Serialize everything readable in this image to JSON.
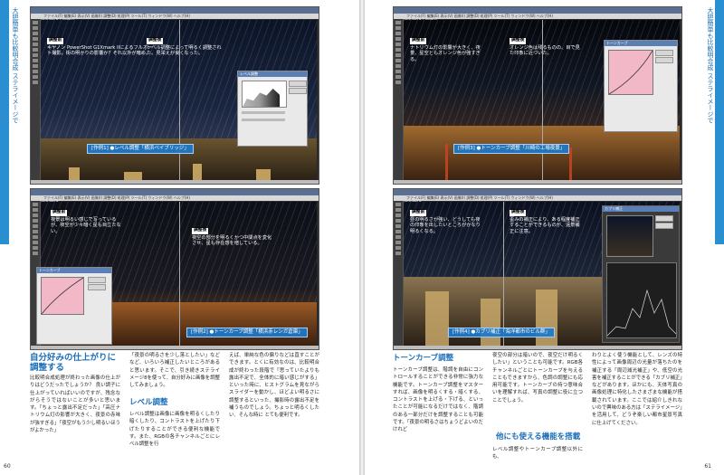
{
  "left_page": {
    "side_label": "大胆簡単も比較明合成 ステライメージで",
    "number": "60",
    "screenshot1": {
      "title": "StellaImage 8 - [作例1]",
      "menu": "ファイル(F) 編集(E) 表示(V) 画像(I) 調整(D) 処理(P) ツール(T) ウィンドウ(W) ヘルプ(H)",
      "note_left_tag": "調整前",
      "note_left_text": "キヤノン PowerShot G1Xmark IIによるフルオート撮影。街の明かりの影響か？それ以外が暗め。",
      "note_right_tag": "調整後",
      "note_right_text": "レベル調整によって明るく調整された。見栄えが良くなった。",
      "caption": "[作例1] ●レベル調整「横浜ベイブリッジ」",
      "dialog_title": "レベル調整"
    },
    "screenshot2": {
      "title": "StellaImage 8",
      "note_left_tag": "調整前",
      "note_left_text": "夜景は明るい感じで写っているが、夜空が少々暗く星も目立たない。",
      "note_right_tag": "調整後",
      "note_right_text": "夜空の部分を明るくかつ中間点を変化させ、星も存在感を増している。",
      "caption": "[作例2] ●トーンカーブ調整「横浜赤レンガ倉庫」",
      "dialog_title": "トーンカーブ"
    },
    "headline": "自分好みの仕上がりに調整する",
    "col1": "比較明合成処理が終わった画像の仕上がりはどうだったでしょうか？ 良い調子に仕上がっていればいいのですが、残念ながらそうではないことが多いと思います。「ちょっと露出不足だった」「高圧ナトリウム灯の影響が大きく、夜景の赤味が強すぎる」「夜空がもう少し明るいほうがよかった」",
    "col2": "「夜景の明るさを少し落としたい」などなど、いろいろ補正したいところがあると思います。そこで、引き続きステライメージ8を使って、自分好みに画像を調整してみましょう。",
    "subhead": "レベル調整",
    "col2b": "レベル調整は画像に画像を明るくしたり暗くしたり、コントラストを上げたり下げたりすることができる便利な機能です。また、RGBの各チャンネルごとにレベル調整を行",
    "col3": "えば、単純な色の偏りなどは直すことができます。とくに有効なのは、比較明合成が終わった段階で「思っていたよりも露出不足で、全体的に暗い感じがする」といった時に、ヒストグラムを見ながらスライダーを動かし、ほどよい明るさに調整するといった、撮影時の露出不足を補うものでしょう。ちょっと明るくしたい、そんな時に とても便利です。"
  },
  "right_page": {
    "side_label": "大胆簡単も比較明合成 ステライメージで",
    "number": "61",
    "screenshot3": {
      "title": "StellaImage 8 - [作例3]",
      "note_left_tag": "調整前",
      "note_left_text": "ナトリウム灯の影響が大きく、夜景、星空ともオレンジ色が強すぎる。",
      "note_right_tag": "調整後",
      "note_right_text": "オレンジ色は残るものの、目で見た印象に近づいた。",
      "caption": "[作例3] ●トーンカーブ調整「川崎の工場夜景」",
      "dialog_title": "トーンカーブ"
    },
    "screenshot4": {
      "title": "StellaImage 8",
      "note_left_tag": "調整前",
      "note_left_text": "昼の明るさが強い、どうしても夜の印象を出したいところがかなり明るくなる。",
      "note_right_tag": "調整後",
      "note_right_text": "歪みの補正により、ある程度補正することができるものが、遠景補正に注意。",
      "caption": "[作例4] ●カブリ補正「海洋都市のビル群」",
      "dialog_title": "カブリ補正"
    },
    "subhead1": "トーンカーブ調整",
    "col1": "トーンカーブ調整は、階調を自由にコントロールすることができる非常に強力な機能です。トーンカーブ調整をマスターすれば、画像を明るくする・暗くする、コントラストを上げる・下げる、といったことが可能になるだけではなく、階調のある一部分だけを調整することも可能です。「夜景の明るさはちょうどよいのだけれど",
    "col2": "夜空の部分は暗いので、夜空だけ明るくしたい」ということも可能です。RGB各チャンネルごとにトーンカーブを与えることもできますから、色調の調整にも応用可能です。トーンカーブの持つ意味合いを理解すれば、写真の調整に役に立つことでしょう。",
    "subhead2": "他にも使える機能を搭載",
    "col2b": "レベル調整やトーンカーブ調整以外にも、",
    "col3": "わりとよく使う機能として、レンズの特性によって画像周辺の光量が落ちたのを補正する「周辺減光補正」や、低空の光害を補正することができる「カブリ補正」などがあります。ほかにも、天体写真の画像処理に特化したさまざまな機能が搭載されています。ここでは紹介しきれないので興味のある方は「ステライメージ」を活用して、どうぞ楽しい都市星景写真に仕上げてください。"
  }
}
